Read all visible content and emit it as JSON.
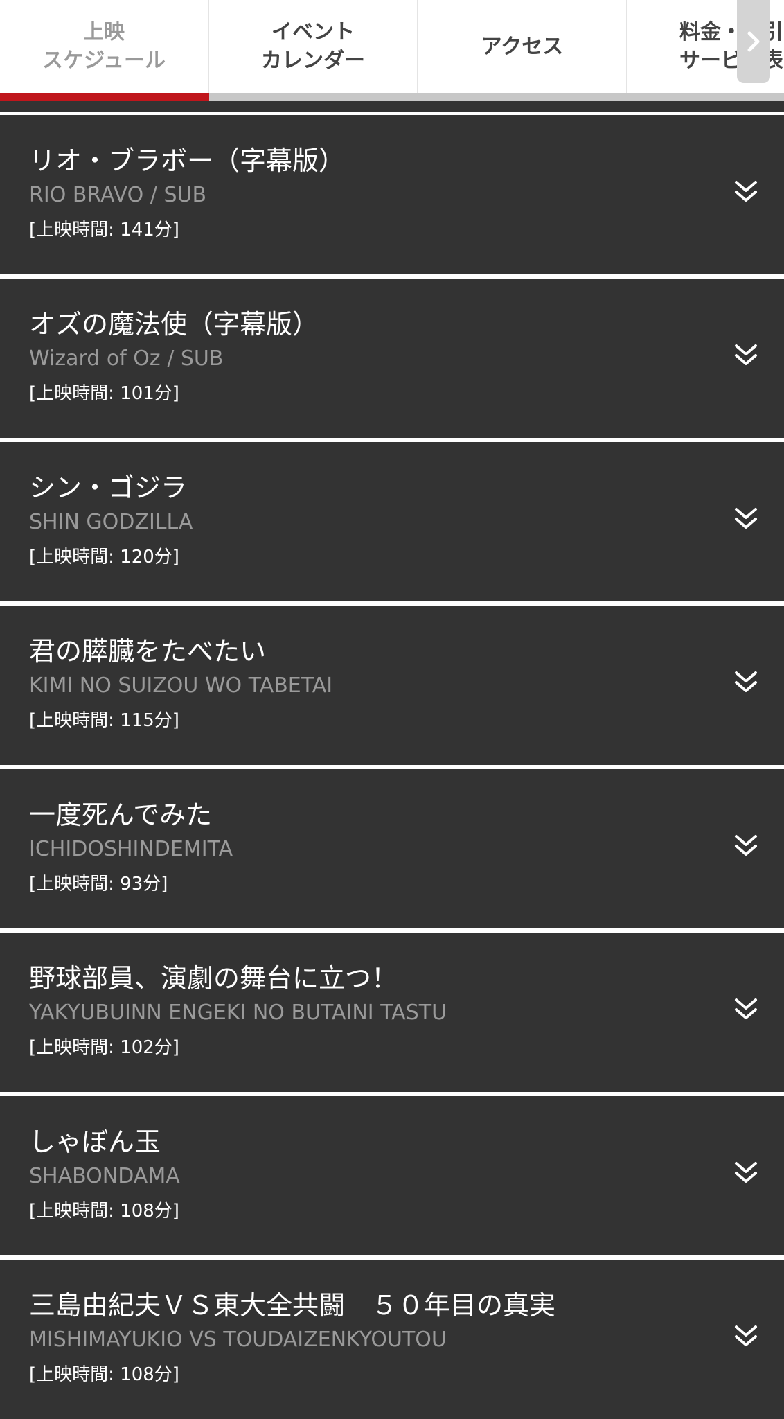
{
  "tabs": [
    {
      "line1": "上映",
      "line2": "スケジュール",
      "active": true
    },
    {
      "line1": "イベント",
      "line2": "カレンダー",
      "active": false
    },
    {
      "line1": "アクセス",
      "line2": "",
      "active": false
    },
    {
      "line1": "料金・割引",
      "line2": "サービス表",
      "active": false
    }
  ],
  "colors": {
    "accent": "#c0161c",
    "card_bg": "#333333",
    "subtitle": "#9a9a9a"
  },
  "icons": {
    "scroll": "chevron-right-icon",
    "expand": "double-chevron-down-icon"
  },
  "movies": [
    {
      "title": "リオ・ブラボー（字幕版）",
      "subtitle": "RIO BRAVO / SUB",
      "runtime": "[上映時間: 141分]"
    },
    {
      "title": "オズの魔法使（字幕版）",
      "subtitle": "Wizard of Oz / SUB",
      "runtime": "[上映時間: 101分]"
    },
    {
      "title": "シン・ゴジラ",
      "subtitle": "SHIN GODZILLA",
      "runtime": "[上映時間: 120分]"
    },
    {
      "title": "君の膵臓をたべたい",
      "subtitle": "KIMI NO SUIZOU WO TABETAI",
      "runtime": "[上映時間: 115分]"
    },
    {
      "title": "一度死んでみた",
      "subtitle": "ICHIDOSHINDEMITA",
      "runtime": "[上映時間: 93分]"
    },
    {
      "title": "野球部員、演劇の舞台に立つ！",
      "subtitle": "YAKYUBUINN ENGEKI NO BUTAINI TASTU",
      "runtime": "[上映時間: 102分]"
    },
    {
      "title": "しゃぼん玉",
      "subtitle": "SHABONDAMA",
      "runtime": "[上映時間: 108分]"
    },
    {
      "title": "三島由紀夫ＶＳ東大全共闘　５０年目の真実",
      "subtitle": "MISHIMAYUKIO VS TOUDAIZENKYOUTOU",
      "runtime": "[上映時間: 108分]"
    }
  ]
}
